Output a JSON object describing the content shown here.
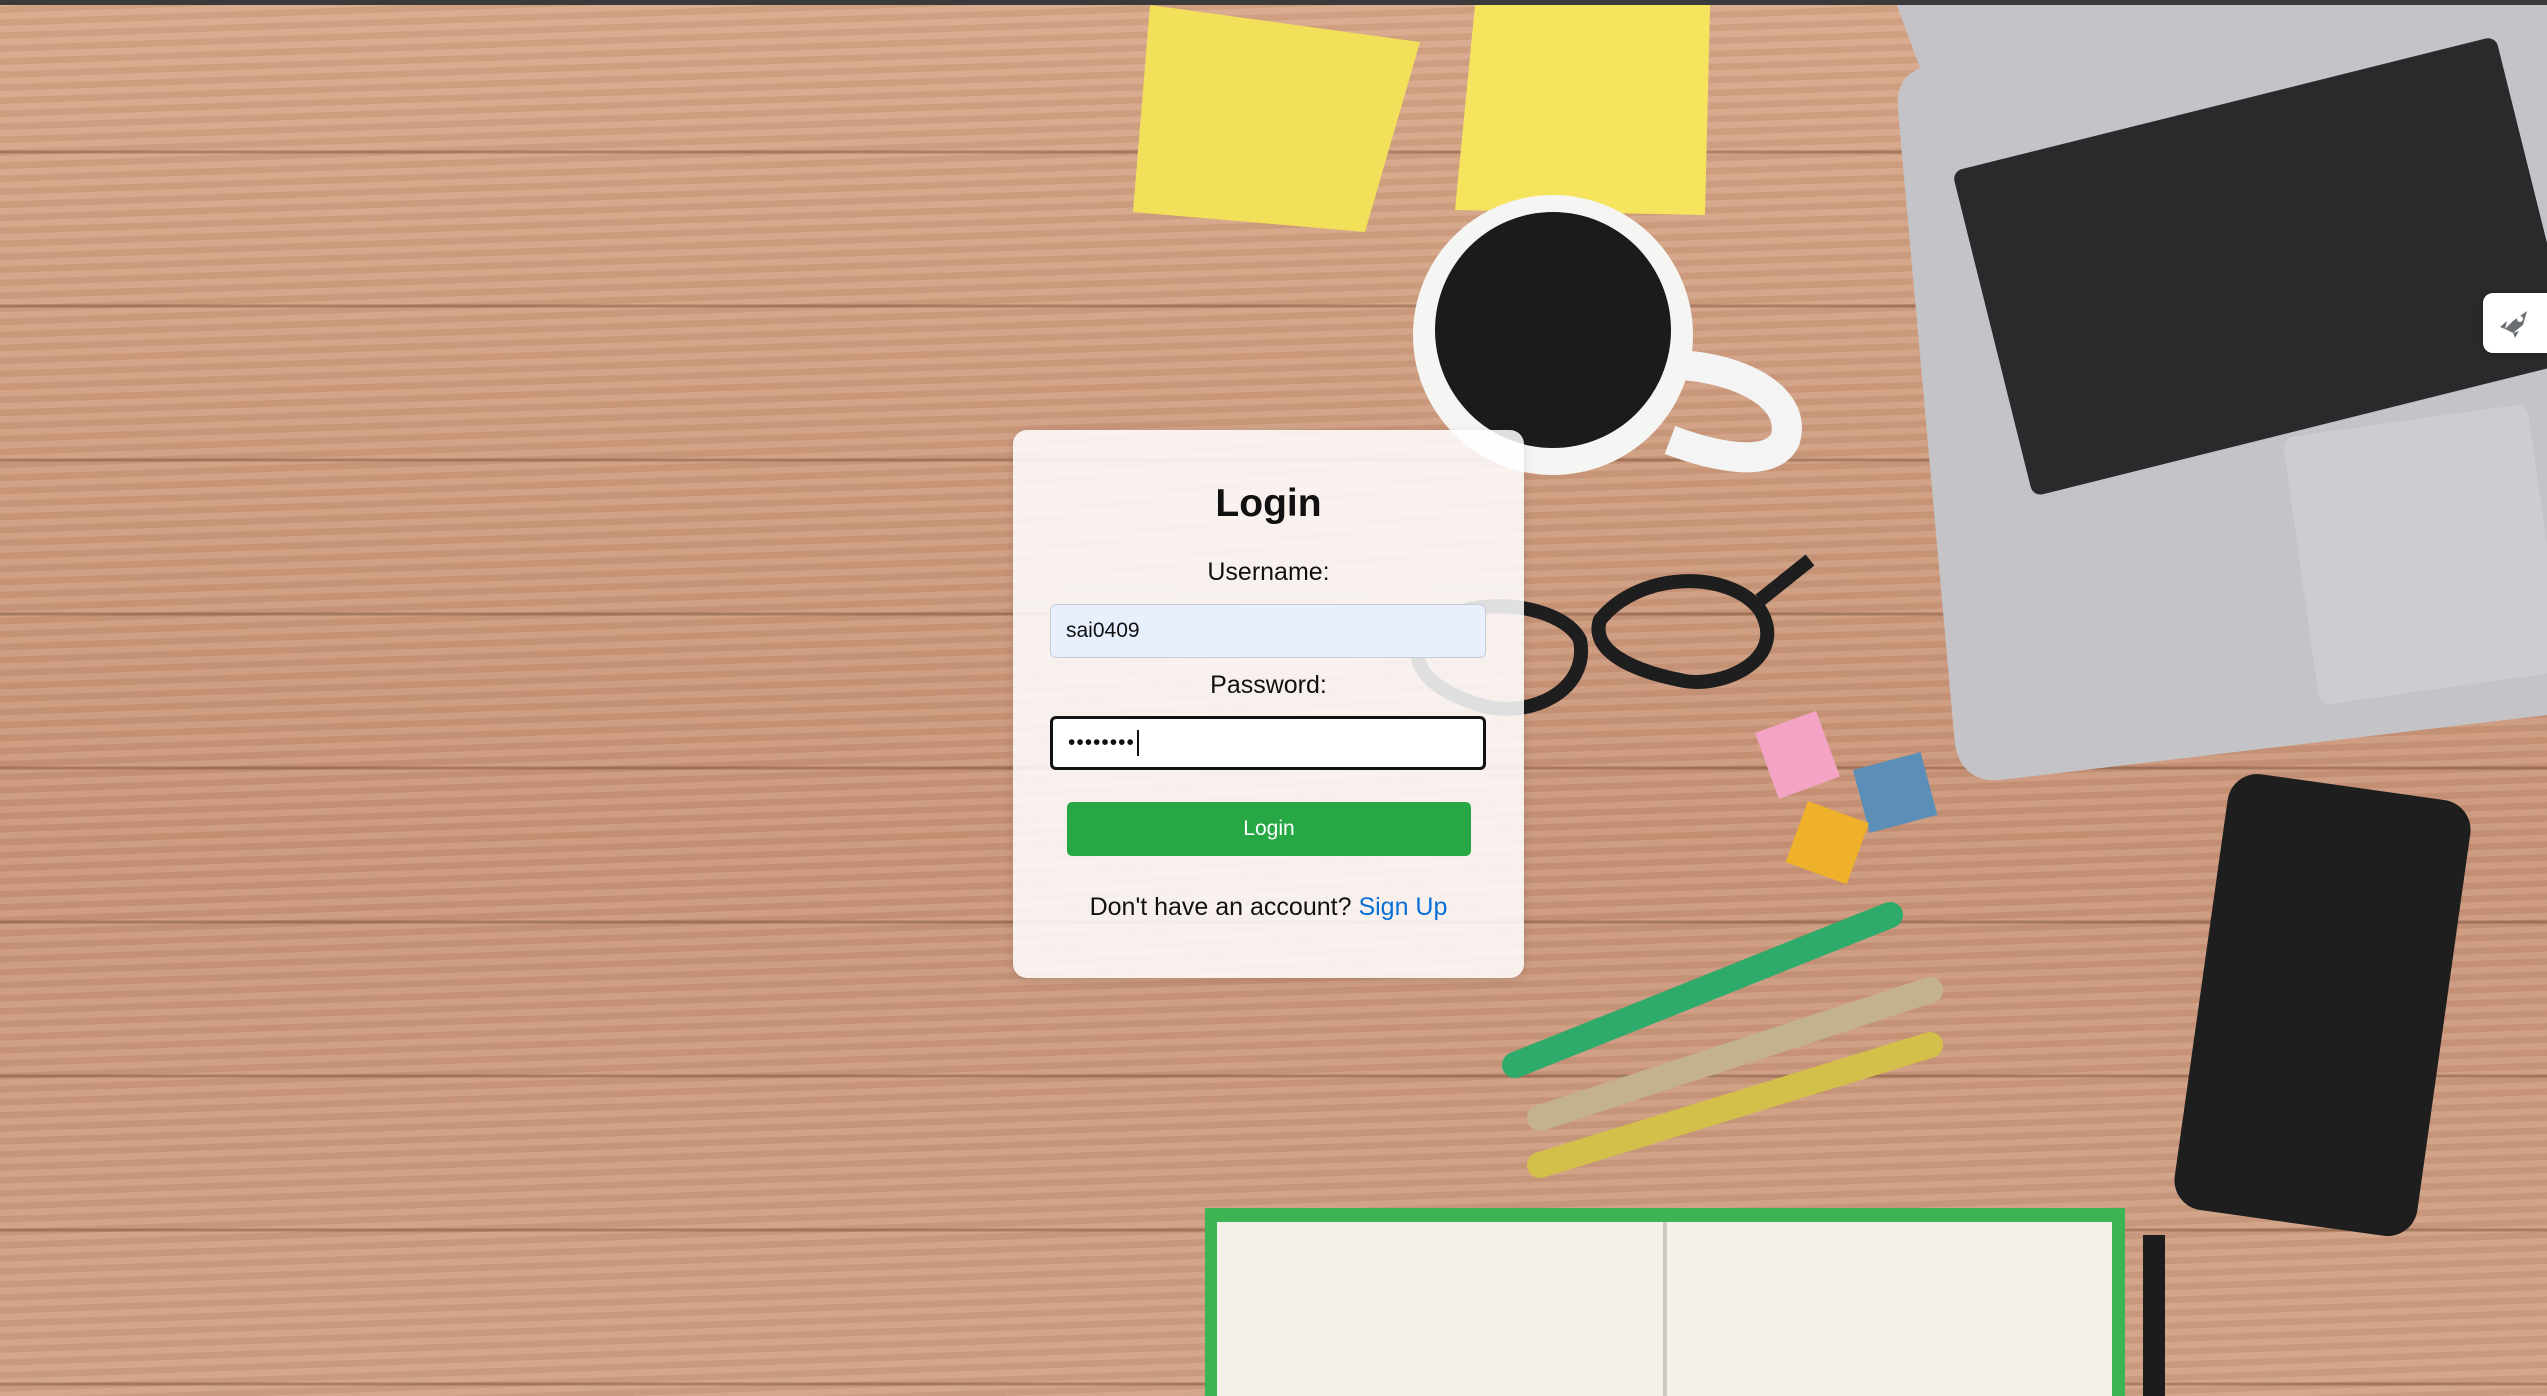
{
  "login": {
    "title": "Login",
    "username_label": "Username:",
    "username_value": "sai0409",
    "password_label": "Password:",
    "password_masked": "••••••••",
    "button_label": "Login",
    "signup_prompt": "Don't have an account?",
    "signup_link": "Sign Up"
  },
  "colors": {
    "button": "#28a745",
    "link": "#0a6fd6",
    "autofill": "#e8f0fe"
  },
  "side_widget": {
    "icon": "rocket-icon"
  }
}
